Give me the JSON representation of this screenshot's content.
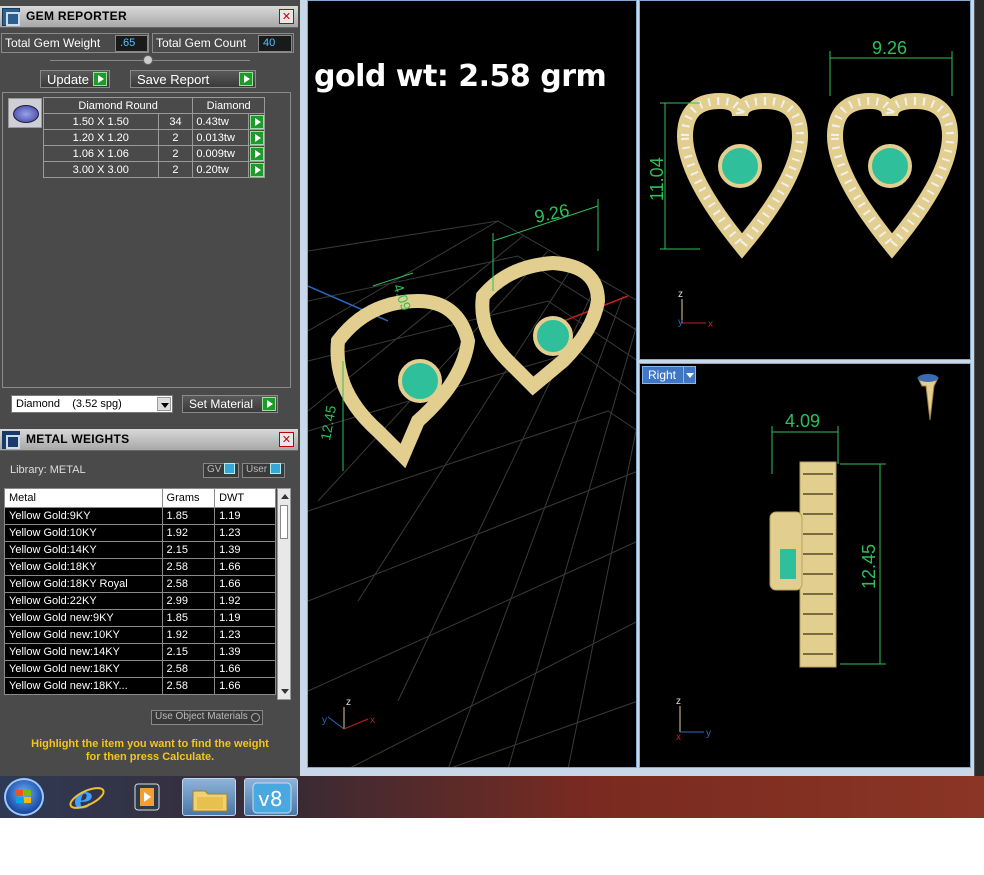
{
  "gem_reporter": {
    "title": "GEM REPORTER",
    "total_gem_weight_label": "Total Gem Weight",
    "total_gem_weight": ".65",
    "total_gem_count_label": "Total Gem Count",
    "total_gem_count": "40",
    "update_label": "Update",
    "save_report_label": "Save Report",
    "table_headers": [
      "Diamond Round",
      "Diamond"
    ],
    "rows": [
      {
        "size": "1.50 X 1.50",
        "count": "34",
        "weight": "0.43tw"
      },
      {
        "size": "1.20 X 1.20",
        "count": "2",
        "weight": "0.013tw"
      },
      {
        "size": "1.06 X 1.06",
        "count": "2",
        "weight": "0.009tw"
      },
      {
        "size": "3.00 X 3.00",
        "count": "2",
        "weight": "0.20tw"
      }
    ],
    "material_select": "Diamond    (3.52 spg)",
    "set_material_label": "Set Material"
  },
  "metal_weights": {
    "title": "METAL WEIGHTS",
    "library_label": "Library: METAL",
    "gv_label": "GV",
    "user_label": "User",
    "headers": [
      "Metal",
      "Grams",
      "DWT"
    ],
    "rows": [
      {
        "metal": "Yellow Gold:9KY",
        "grams": "1.85",
        "dwt": "1.19"
      },
      {
        "metal": "Yellow Gold:10KY",
        "grams": "1.92",
        "dwt": "1.23"
      },
      {
        "metal": "Yellow Gold:14KY",
        "grams": "2.15",
        "dwt": "1.39"
      },
      {
        "metal": "Yellow Gold:18KY",
        "grams": "2.58",
        "dwt": "1.66"
      },
      {
        "metal": "Yellow Gold:18KY Royal",
        "grams": "2.58",
        "dwt": "1.66"
      },
      {
        "metal": "Yellow Gold:22KY",
        "grams": "2.99",
        "dwt": "1.92"
      },
      {
        "metal": "Yellow Gold new:9KY",
        "grams": "1.85",
        "dwt": "1.19"
      },
      {
        "metal": "Yellow Gold new:10KY",
        "grams": "1.92",
        "dwt": "1.23"
      },
      {
        "metal": "Yellow Gold new:14KY",
        "grams": "2.15",
        "dwt": "1.39"
      },
      {
        "metal": "Yellow Gold new:18KY",
        "grams": "2.58",
        "dwt": "1.66"
      },
      {
        "metal": "Yellow Gold new:18KY...",
        "grams": "2.58",
        "dwt": "1.66"
      }
    ],
    "use_object_materials_label": "Use Object Materials",
    "hint_line1": "Highlight the item you want to find the weight",
    "hint_line2": "for then press Calculate."
  },
  "viewports": {
    "annotation": "gold wt: 2.58 grm",
    "right_view_label": "Right",
    "dims": {
      "persp_width": "9.26",
      "persp_small": "4.09",
      "persp_height": "12.45",
      "front_width": "9.26",
      "front_height": "11.04",
      "right_width": "4.09",
      "right_height": "12.45"
    },
    "axes": {
      "x": "x",
      "y": "y",
      "z": "z"
    }
  },
  "colors": {
    "accent_green": "#2fbf5a",
    "hint_yellow": "#f5c518",
    "value_blue": "#4fc3ff",
    "gold": "#e2cf8f",
    "emerald": "#2fbf9a"
  },
  "taskbar": {
    "icons": [
      "windows-start-icon",
      "internet-explorer-icon",
      "media-player-icon",
      "file-explorer-icon",
      "v8-app-icon"
    ],
    "v8_label": "v8"
  }
}
